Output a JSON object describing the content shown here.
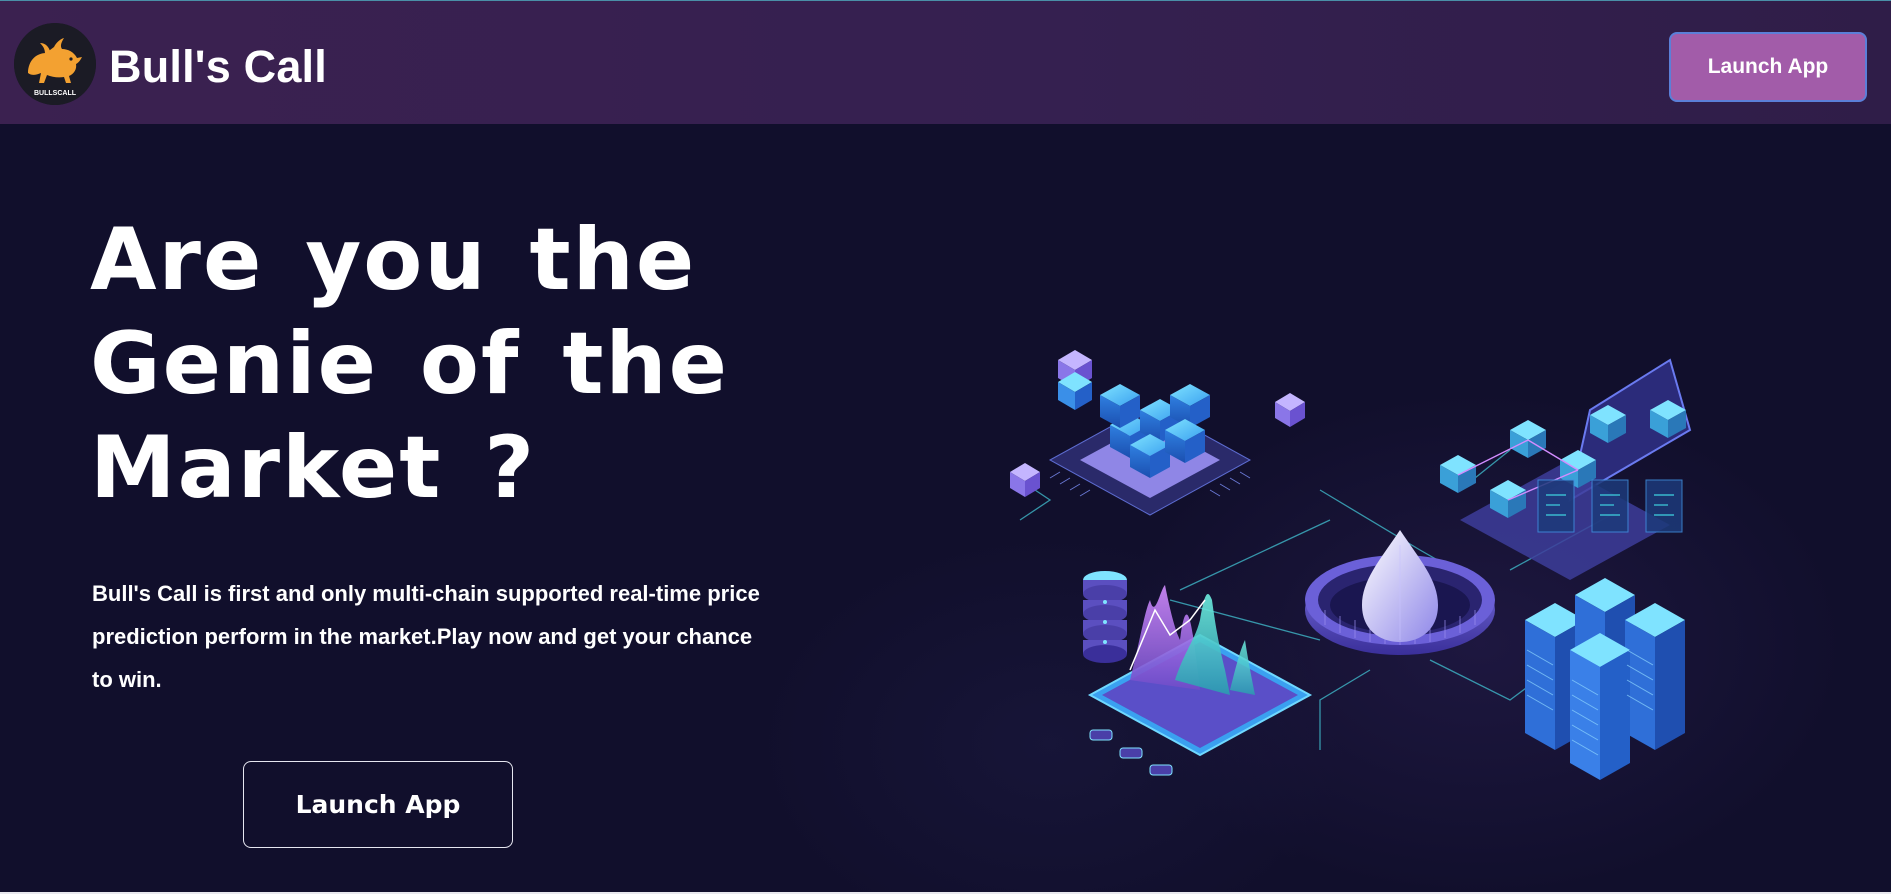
{
  "header": {
    "logo_text": "BULLSCALL",
    "brand_name": "Bull's Call",
    "launch_button_label": "Launch App"
  },
  "hero": {
    "headline": "Are you the Genie of the Market ?",
    "description": "Bull's Call is first and only multi-chain supported real-time price prediction perform in the market.Play now and get your chance to win.",
    "launch_button_label": "Launch App"
  },
  "icons": {
    "logo": "bull-icon",
    "illustration": "blockchain-illustration"
  },
  "colors": {
    "navbar": "#37204f",
    "background": "#110f2c",
    "nav_button": "#a25ca9",
    "nav_button_border": "#5b7fd8",
    "bull": "#f3a131",
    "accent_cyan": "#3fd3e0",
    "accent_purple": "#8b6be0"
  }
}
